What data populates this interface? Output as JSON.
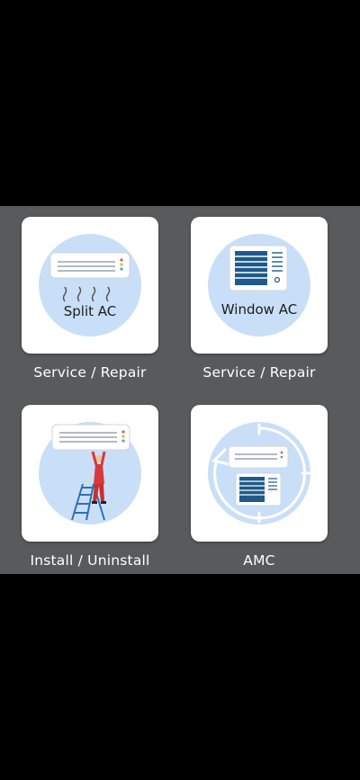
{
  "services": [
    {
      "id": "split-ac",
      "tile_label": "Split AC",
      "caption": "Service / Repair"
    },
    {
      "id": "window-ac",
      "tile_label": "Window AC",
      "caption": "Service / Repair"
    },
    {
      "id": "install",
      "tile_label": "",
      "caption": "Install / Uninstall"
    },
    {
      "id": "amc",
      "tile_label": "",
      "caption": "AMC"
    }
  ],
  "colors": {
    "panel_bg": "#595a5c",
    "circle_fill": "#c9dff7",
    "ac_body": "#ffffff",
    "accent_blue": "#1e5a8a",
    "worker_red": "#d63a3a"
  },
  "icons": [
    "split-ac-icon",
    "window-ac-icon",
    "install-technician-icon",
    "amc-cycle-icon"
  ]
}
